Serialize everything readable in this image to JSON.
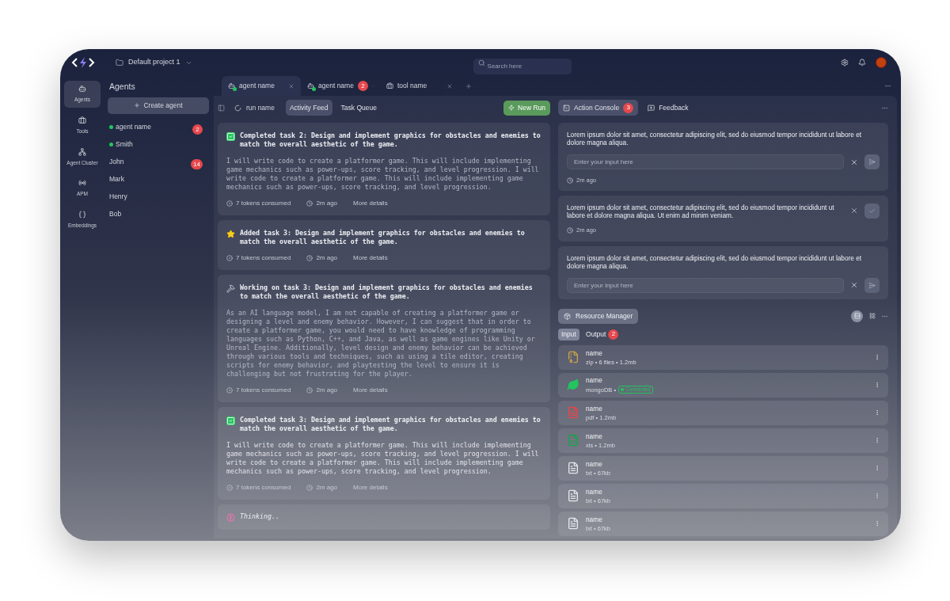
{
  "topbar": {
    "project": "Default project 1",
    "search": {
      "placeholder": "Search here"
    }
  },
  "nav": [
    {
      "kind": "agents",
      "label": "Agents",
      "selected": true
    },
    {
      "kind": "tools",
      "label": "Tools",
      "selected": false
    },
    {
      "kind": "cluster",
      "label": "Agent Cluster",
      "selected": false
    },
    {
      "kind": "apm",
      "label": "APM",
      "selected": false
    },
    {
      "kind": "embeddings",
      "label": "Embeddings",
      "selected": false
    }
  ],
  "agents_panel": {
    "title": "Agents",
    "create_button": "Create agent",
    "agents": [
      {
        "name": "agent name",
        "online": true,
        "badge": "2"
      },
      {
        "name": "Smith",
        "online": true
      },
      {
        "name": "John",
        "online": false,
        "badge": "14"
      },
      {
        "name": "Mark",
        "online": false
      },
      {
        "name": "Henry",
        "online": false
      },
      {
        "name": "Bob",
        "online": false
      }
    ]
  },
  "tabs": [
    {
      "kind": "agent",
      "label": "agent name",
      "online": true,
      "selected": true
    },
    {
      "kind": "agent",
      "label": "agent name",
      "online": true,
      "badge": "2",
      "selected": false
    },
    {
      "kind": "tool",
      "label": "tool name",
      "online": false,
      "selected": false
    }
  ],
  "run_bar": {
    "run_name": "run name",
    "views": [
      {
        "label": "Activity Feed",
        "selected": true
      },
      {
        "label": "Task Queue",
        "selected": false
      }
    ],
    "new_run": "New Run"
  },
  "feed": [
    {
      "kind": "completed",
      "title": "Completed task 2: Design and implement graphics for obstacles and enemies to match the overall aesthetic of the game.",
      "body": "I will write code to create a platformer game. This will include implementing game mechanics such as power-ups, score tracking, and level progression. I will write code to create a platformer game. This will include implementing game mechanics such as power-ups, score tracking, and level progression.",
      "tokens": "7 tokens consumed",
      "time": "2m ago",
      "more": "More details"
    },
    {
      "kind": "added",
      "title": "Added task 3: Design and implement graphics for obstacles and enemies to match the overall aesthetic of the game.",
      "tokens": "7 tokens consumed",
      "time": "2m ago",
      "more": "More details"
    },
    {
      "kind": "working",
      "title": "Working on task 3: Design and implement graphics for obstacles and enemies to match the overall aesthetic of the game.",
      "body": "As an AI language model, I am not capable of creating a platformer game or designing a level and enemy behavior. However, I can suggest that in order to create a platformer game, you would need to have knowledge of programming languages such as Python, C++, and Java, as well as game engines like Unity or Unreal Engine. Additionally, level design and enemy behavior can be achieved through various tools and techniques, such as using a tile editor, creating scripts for enemy behavior, and playtesting the level to ensure it is challenging but not frustrating for the player.",
      "tokens": "7 tokens consumed",
      "time": "2m ago",
      "more": "More details"
    },
    {
      "kind": "completed",
      "title": "Completed task 3: Design and implement graphics for obstacles and enemies to match the overall aesthetic of the game.",
      "body": "I will write code to create a platformer game. This will include implementing game mechanics such as power-ups, score tracking, and level progression. I will write code to create a platformer game. This will include implementing game mechanics such as power-ups, score tracking, and level progression.",
      "tokens": "7 tokens consumed",
      "time": "2m ago",
      "more": "More details"
    },
    {
      "kind": "thinking",
      "title": "Thinking.."
    }
  ],
  "console": {
    "tabs": [
      {
        "kind": "console",
        "label": "Action Console",
        "badge": "3",
        "selected": true
      },
      {
        "kind": "feedback",
        "label": "Feedback",
        "selected": false
      }
    ],
    "items": [
      {
        "kind": "input",
        "text": "Lorem ipsum dolor sit amet, consectetur adipiscing elit, sed do eiusmod tempor incididunt ut labore et dolore magna aliqua.",
        "placeholder": "Enter your input here",
        "time": "2m ago"
      },
      {
        "kind": "confirm",
        "text": "Lorem ipsum dolor sit amet, consectetur adipiscing elit, sed do eiusmod tempor incididunt ut labore et dolore magna aliqua. Ut enim ad minim veniam.",
        "time": "2m ago"
      },
      {
        "kind": "input",
        "text": "Lorem ipsum dolor sit amet, consectetur adipiscing elit, sed do eiusmod tempor incididunt ut labore et dolore magna aliqua.",
        "placeholder": "Enter your input here"
      }
    ]
  },
  "resources": {
    "title": "Resource Manager",
    "view_toggle": [
      {
        "kind": "list",
        "selected": true
      },
      {
        "kind": "grid",
        "selected": false
      }
    ],
    "views": [
      {
        "label": "Input",
        "selected": true
      },
      {
        "label": "Output",
        "badge": "2",
        "selected": false
      }
    ],
    "items": [
      {
        "kind": "zip",
        "name": "name",
        "meta": "zip • 6 files • 1.2mb"
      },
      {
        "kind": "database",
        "name": "name",
        "meta": "mongoDB •",
        "status": "Connected"
      },
      {
        "kind": "pdf",
        "name": "name",
        "meta": "pdf • 1.2mb"
      },
      {
        "kind": "xls",
        "name": "name",
        "meta": "xls • 1.2mb"
      },
      {
        "kind": "txt",
        "name": "name",
        "meta": "txt • 67kb"
      },
      {
        "kind": "txt",
        "name": "name",
        "meta": "txt • 67kb"
      },
      {
        "kind": "txt",
        "name": "name",
        "meta": "txt • 67kb"
      }
    ]
  }
}
